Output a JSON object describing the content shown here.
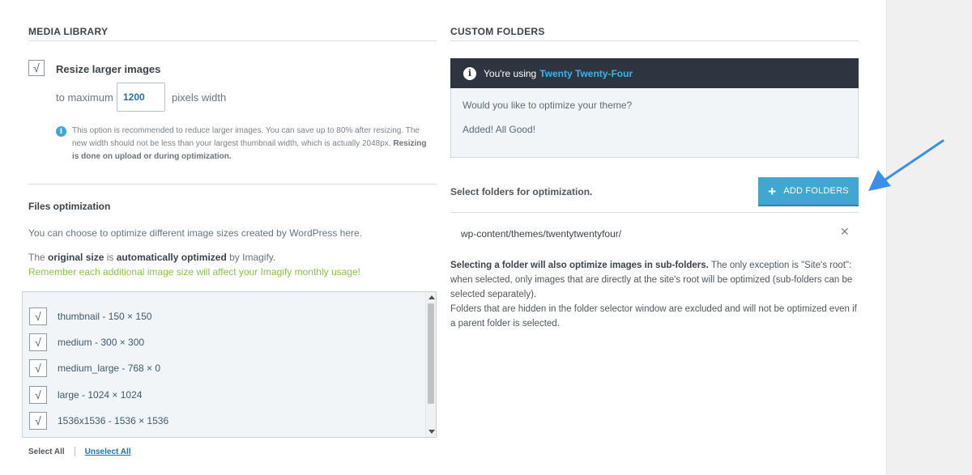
{
  "media_library": {
    "title": "MEDIA LIBRARY",
    "resize_label": "Resize larger images",
    "to_maximum": "to maximum",
    "width_value": "1200",
    "pixels_width": "pixels width",
    "note_line1": "This option is recommended to reduce larger images. You can save up to 80% after resizing. The",
    "note_line2": "new width should not be less than your largest thumbnail width, which is actually 2048px.",
    "note_bold_a": "Resizing",
    "note_bold_b": "is done on upload or during optimization."
  },
  "files_optimization": {
    "title": "Files optimization",
    "description": "You can choose to optimize different image sizes created by WordPress here.",
    "original_prefix": "The",
    "original_bold": "original size",
    "original_middle": "is",
    "original_bold2": "automatically optimized",
    "original_suffix": "by Imagify.",
    "warning": "Remember each additional image size will affect your Imagify monthly usage!",
    "sizes": [
      {
        "label": "thumbnail - 150 × 150",
        "checked": true
      },
      {
        "label": "medium - 300 × 300",
        "checked": true
      },
      {
        "label": "medium_large - 768 × 0",
        "checked": true
      },
      {
        "label": "large - 1024 × 1024",
        "checked": true
      },
      {
        "label": "1536x1536 - 1536 × 1536",
        "checked": true
      }
    ],
    "select_all": "Select All",
    "unselect_all": "Unselect All"
  },
  "custom_folders": {
    "title": "CUSTOM FOLDERS",
    "using_text": "You're using",
    "theme_name": "Twenty Twenty-Four",
    "question": "Would you like to optimize your theme?",
    "added": "Added! All Good!",
    "select_label": "Select folders for optimization.",
    "add_button": "ADD FOLDERS",
    "folder_path": "wp-content/themes/twentytwentyfour/",
    "explain_bold": "Selecting a folder will also optimize images in sub-folders.",
    "explain_rest": "The only exception is \"Site's root\": when selected, only images that are directly at the site's root will be optimized (sub-folders can be selected separately).",
    "explain_line2": "Folders that are hidden in the folder selector window are excluded and will not be optimized even if a parent folder is selected."
  },
  "colors": {
    "accent_blue": "#40a7d0",
    "theme_name": "#40b1e6",
    "dark_header": "#2f3441",
    "warning_green": "#8bc34a",
    "annotation_arrow": "#3a8fe8"
  },
  "icons": {
    "check": "check-icon",
    "info": "info-icon",
    "plus": "plus-icon",
    "close": "close-icon",
    "annotation": "arrow-annotation-icon"
  }
}
